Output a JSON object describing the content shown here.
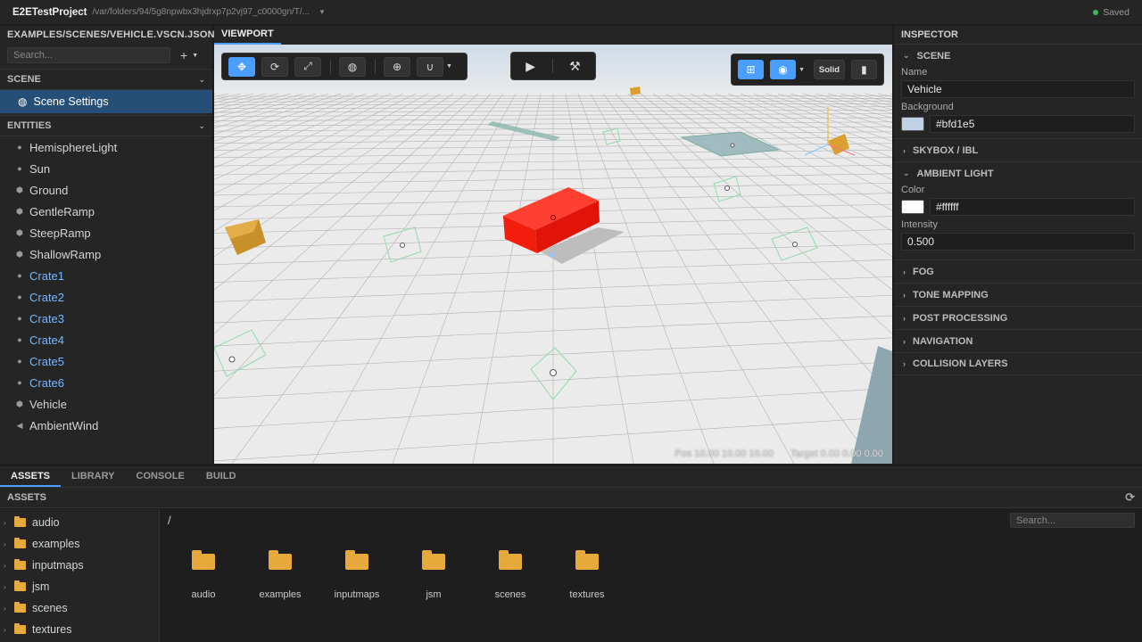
{
  "titlebar": {
    "app_title": "E2ETestProject",
    "path": "/var/folders/94/5g8npwbx3hjdrxp7p2vj97_c0000gn/T/...",
    "status": "Saved"
  },
  "left": {
    "title": "EXAMPLES/SCENES/VEHICLE.VSCN.JSON",
    "search_placeholder": "Search...",
    "scene_header": "SCENE",
    "scene_settings": "Scene Settings",
    "entities_header": "ENTITIES",
    "entities": [
      {
        "label": "HemisphereLight",
        "icon": "light-bulb-icon"
      },
      {
        "label": "Sun",
        "icon": "light-bulb-icon"
      },
      {
        "label": "Ground",
        "icon": "cube-icon"
      },
      {
        "label": "GentleRamp",
        "icon": "cube-icon"
      },
      {
        "label": "SteepRamp",
        "icon": "cube-icon"
      },
      {
        "label": "ShallowRamp",
        "icon": "cube-icon"
      },
      {
        "label": "Crate1",
        "icon": "circle-icon"
      },
      {
        "label": "Crate2",
        "icon": "circle-icon"
      },
      {
        "label": "Crate3",
        "icon": "circle-icon"
      },
      {
        "label": "Crate4",
        "icon": "circle-icon"
      },
      {
        "label": "Crate5",
        "icon": "circle-icon"
      },
      {
        "label": "Crate6",
        "icon": "circle-icon"
      },
      {
        "label": "Vehicle",
        "icon": "cube-icon"
      },
      {
        "label": "AmbientWind",
        "icon": "speaker-icon"
      }
    ]
  },
  "viewport": {
    "tab": "VIEWPORT",
    "solid_label": "Solid",
    "pos": "Pos 10.00 10.00 10.00",
    "target": "Target 0.00 0.00 0.00"
  },
  "inspector": {
    "title": "INSPECTOR",
    "scene_section": "SCENE",
    "name_label": "Name",
    "name_value": "Vehicle",
    "background_label": "Background",
    "background_value": "#bfd1e5",
    "skybox": "SKYBOX / IBL",
    "ambient": "AMBIENT LIGHT",
    "color_label": "Color",
    "color_value": "#ffffff",
    "intensity_label": "Intensity",
    "intensity_value": "0.500",
    "sections": [
      "FOG",
      "TONE MAPPING",
      "POST PROCESSING",
      "NAVIGATION",
      "COLLISION LAYERS"
    ]
  },
  "bottom": {
    "tabs": [
      "ASSETS",
      "LIBRARY",
      "CONSOLE",
      "BUILD"
    ],
    "assets_header": "ASSETS",
    "breadcrumb": "/",
    "search_placeholder": "Search...",
    "folders": [
      "audio",
      "examples",
      "inputmaps",
      "jsm",
      "scenes",
      "textures"
    ]
  },
  "colors": {
    "accent": "#4a9eff",
    "selection": "#264f78",
    "crate_text": "#75b8ff",
    "vehicle_red": "#ff1a0a",
    "folder": "#e8a93c"
  }
}
